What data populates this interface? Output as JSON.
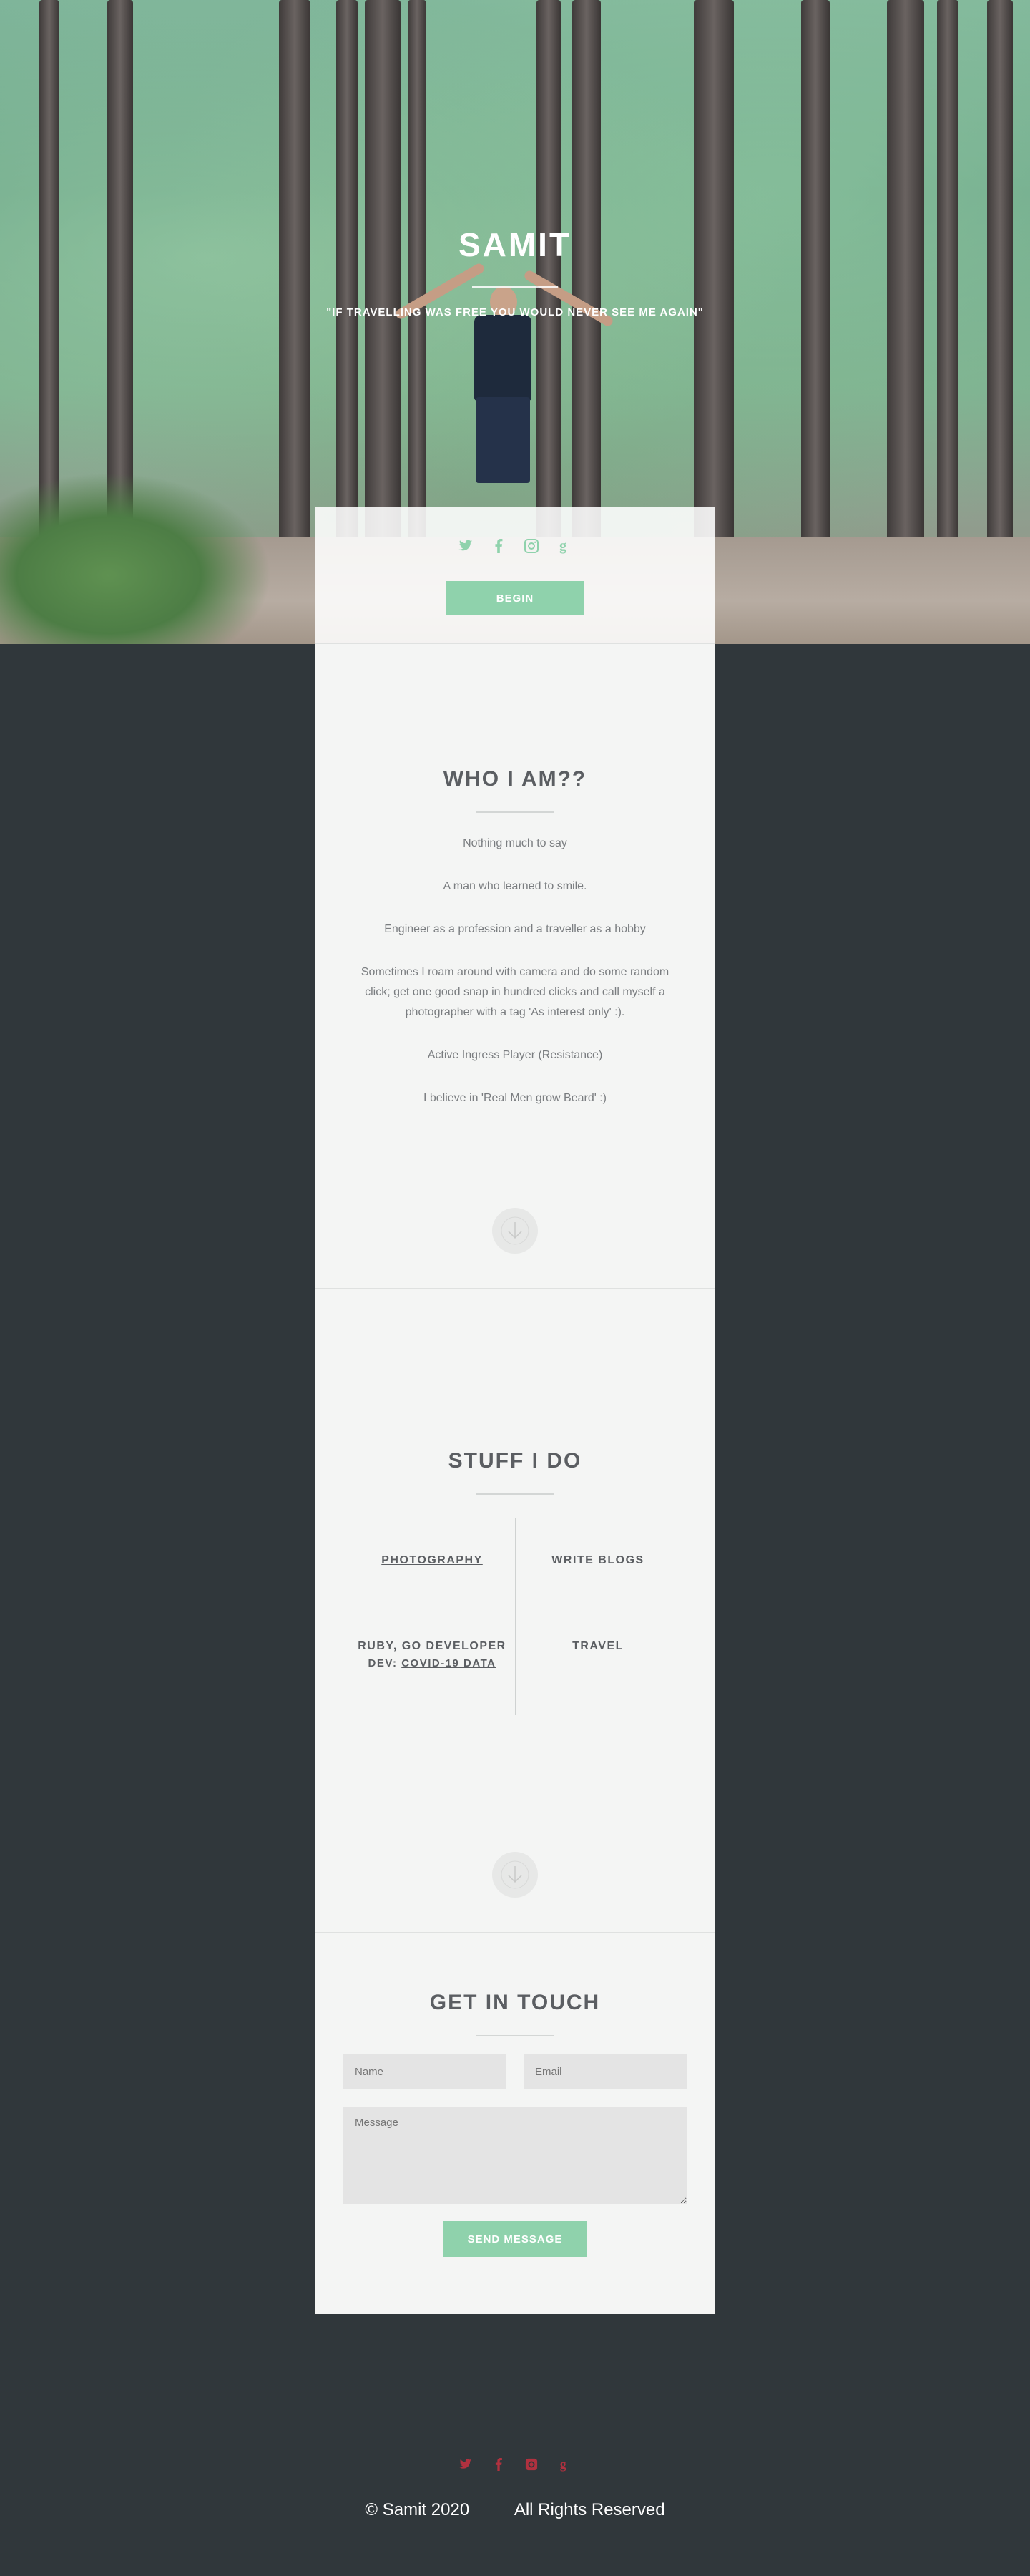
{
  "hero": {
    "title": "SAMIT",
    "quote": "\"IF TRAVELLING WAS FREE YOU WOULD NEVER SEE ME AGAIN\""
  },
  "social": {
    "icons": [
      "twitter-icon",
      "facebook-icon",
      "instagram-icon",
      "google-plus-icon"
    ],
    "accent_color": "#8fd2ac"
  },
  "begin_button": "BEGIN",
  "about": {
    "title": "WHO I AM??",
    "lines": [
      "Nothing much to say",
      "A man who learned to smile.",
      "Engineer as a profession and a traveller as a hobby",
      "Sometimes I roam around with camera and do some random click; get one good snap in hundred clicks and call myself a photographer with a tag 'As interest only' :).",
      "Active Ingress Player (Resistance)",
      "I believe in 'Real Men grow Beard' :)"
    ]
  },
  "stuff": {
    "title": "STUFF I DO",
    "items": {
      "photography": "PHOTOGRAPHY",
      "blogs": "WRITE BLOGS",
      "developer": "RUBY, GO DEVELOPER",
      "dev_prefix": "DEV:",
      "dev_link": "COVID-19 DATA",
      "travel": "TRAVEL"
    }
  },
  "contact": {
    "title": "GET IN TOUCH",
    "name_placeholder": "Name",
    "email_placeholder": "Email",
    "message_placeholder": "Message",
    "send_button": "SEND MESSAGE"
  },
  "footer": {
    "copyright": "© Samit 2020",
    "rights": "All Rights Reserved",
    "social_color": "#b0313f"
  }
}
